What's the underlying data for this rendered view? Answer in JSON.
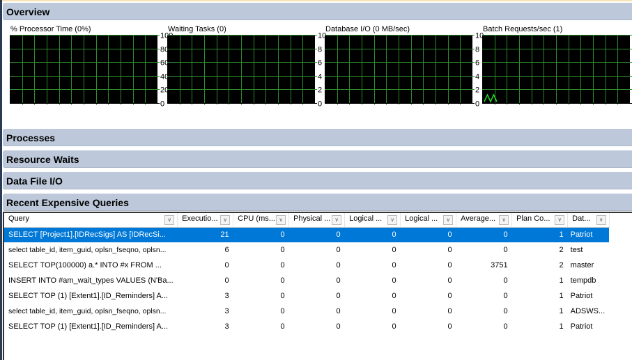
{
  "sections": {
    "overview": "Overview",
    "processes": "Processes",
    "resource_waits": "Resource Waits",
    "data_file_io": "Data File I/O",
    "recent_expensive_queries": "Recent Expensive Queries"
  },
  "chart_data": [
    {
      "type": "line",
      "title": "% Processor Time (0%)",
      "yticks": [
        "100",
        "80",
        "60",
        "40",
        "20",
        "0"
      ],
      "ylim": [
        0,
        100
      ],
      "grid": true,
      "series": [
        {
          "name": "% Processor Time",
          "values": []
        }
      ]
    },
    {
      "type": "line",
      "title": "Waiting Tasks (0)",
      "yticks": [
        "10",
        "8",
        "6",
        "4",
        "2",
        "0"
      ],
      "ylim": [
        0,
        10
      ],
      "grid": true,
      "series": [
        {
          "name": "Waiting Tasks",
          "values": []
        }
      ]
    },
    {
      "type": "line",
      "title": "Database I/O (0 MB/sec)",
      "yticks": [
        "10",
        "8",
        "6",
        "4",
        "2",
        "0"
      ],
      "ylim": [
        0,
        10
      ],
      "grid": true,
      "series": [
        {
          "name": "Database I/O",
          "values": []
        }
      ]
    },
    {
      "type": "line",
      "title": "Batch Requests/sec (1)",
      "yticks": [
        "10",
        "8",
        "6",
        "4",
        "2",
        "0"
      ],
      "ylim": [
        0,
        10
      ],
      "grid": true,
      "series": [
        {
          "name": "Batch Requests/sec",
          "values": [
            0,
            1,
            0,
            1,
            0
          ]
        }
      ]
    }
  ],
  "queries_table": {
    "columns": [
      "Query",
      "Executio...",
      "CPU (ms...",
      "Physical ...",
      "Logical ...",
      "Logical ...",
      "Average...",
      "Plan Co...",
      "Dat..."
    ],
    "rows": [
      [
        "SELECT     [Project1].[IDRecSigs] AS [IDRecSi...",
        "21",
        "0",
        "0",
        "0",
        "0",
        "0",
        "1",
        "Patriot"
      ],
      [
        "select table_id, item_guid, oplsn_fseqno, oplsn...",
        "6",
        "0",
        "0",
        "0",
        "0",
        "0",
        "2",
        "test"
      ],
      [
        "SELECT TOP(100000)      a.* INTO #x FROM    ...",
        "0",
        "0",
        "0",
        "0",
        "0",
        "3751",
        "2",
        "master"
      ],
      [
        "INSERT INTO #am_wait_types VALUES (N'Ba...",
        "0",
        "0",
        "0",
        "0",
        "0",
        "0",
        "1",
        "tempdb"
      ],
      [
        "SELECT TOP (1)     [Extent1].[ID_Reminders] A...",
        "3",
        "0",
        "0",
        "0",
        "0",
        "0",
        "1",
        "Patriot"
      ],
      [
        "select table_id, item_guid, oplsn_fseqno, oplsn...",
        "3",
        "0",
        "0",
        "0",
        "0",
        "0",
        "1",
        "ADSWS..."
      ],
      [
        "SELECT TOP (1)     [Extent1].[ID_Reminders] A...",
        "3",
        "0",
        "0",
        "0",
        "0",
        "0",
        "1",
        "Patriot"
      ]
    ],
    "selected_row": 0
  },
  "colors": {
    "chart_bg": "#000000",
    "grid_line": "#2e8b2e",
    "series_line": "#22dd22",
    "selection": "#0078d7",
    "section_header": "#bdc9da"
  }
}
